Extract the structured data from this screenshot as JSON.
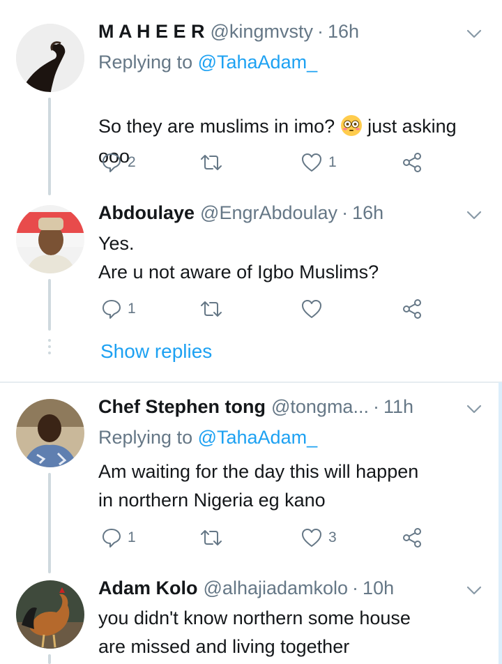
{
  "tweets": [
    {
      "name": "M A H E E R",
      "handle": "@kingmvsty",
      "time": "16h",
      "replying_prefix": "Replying to ",
      "replying_to": "@TahaAdam_",
      "text_before_emoji": "So they are muslims in imo? ",
      "text_after_emoji": " just asking ooo",
      "emoji_icon": "flushed-face-emoji",
      "replies": "2",
      "retweets": "",
      "likes": "1"
    },
    {
      "name": "Abdoulaye",
      "handle": "@EngrAbdoulay",
      "time": "16h",
      "text": "Yes.\nAre u not aware of Igbo Muslims?",
      "replies": "1",
      "retweets": "",
      "likes": ""
    },
    {
      "name": "Chef Stephen tong",
      "handle": "@tongma...",
      "time": "11h",
      "replying_prefix": "Replying to ",
      "replying_to": "@TahaAdam_",
      "text": "Am waiting for the day this will happen\nin northern Nigeria eg kano",
      "replies": "1",
      "retweets": "",
      "likes": "3"
    },
    {
      "name": "Adam Kolo",
      "handle": "@alhajiadamkolo",
      "time": "10h",
      "text": "you didn't know northern some house\nare missed and living together"
    }
  ],
  "show_replies_label": "Show replies",
  "colors": {
    "accent": "#1da1f2",
    "muted": "#657786",
    "connector": "#cfd9de",
    "divider": "#e6ecf0"
  }
}
